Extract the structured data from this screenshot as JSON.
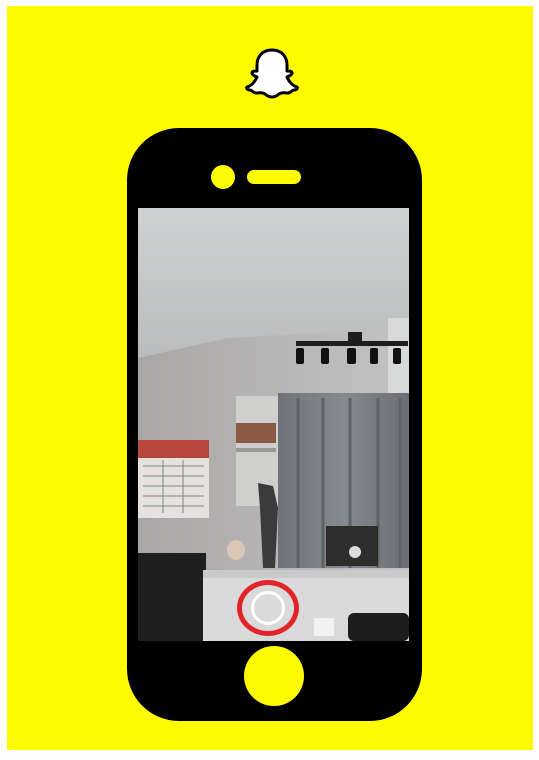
{
  "app": {
    "name": "Snapchat",
    "brand_color": "#fffc00",
    "accent_color": "#e3242b"
  },
  "header": {
    "logo_icon": "ghost-icon"
  },
  "phone": {
    "screen": {
      "content": "camera-preview",
      "capture_button_icon": "shutter-icon"
    },
    "home_button_icon": "home-button-icon"
  }
}
